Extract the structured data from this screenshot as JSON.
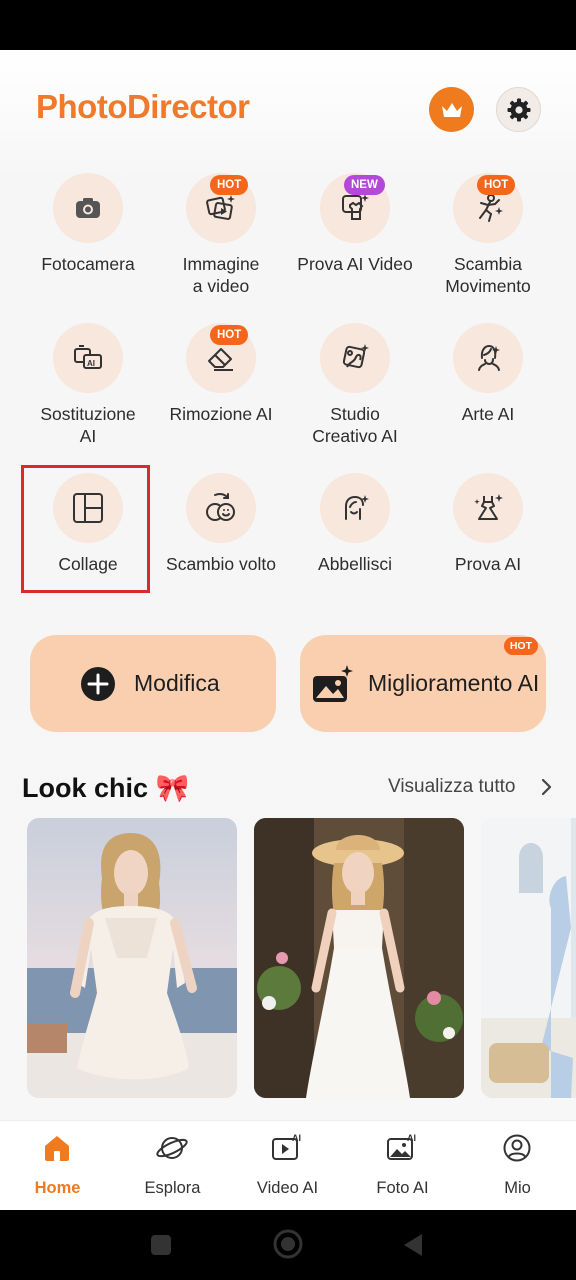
{
  "app": {
    "title": "PhotoDirector"
  },
  "tools": [
    {
      "label": "Fotocamera",
      "icon": "camera-icon"
    },
    {
      "label": "Immagine a video",
      "icon": "image-to-video-icon",
      "badge": "HOT"
    },
    {
      "label": "Prova AI Video",
      "icon": "ai-video-try-on-icon",
      "badge": "NEW"
    },
    {
      "label": "Scambia Movimento",
      "icon": "motion-swap-icon",
      "badge": "HOT"
    },
    {
      "label": "Sostituzione AI",
      "icon": "ai-replace-icon"
    },
    {
      "label": "Rimozione AI",
      "icon": "eraser-icon",
      "badge": "HOT"
    },
    {
      "label": "Studio Creativo AI",
      "icon": "creative-studio-icon"
    },
    {
      "label": "Arte AI",
      "icon": "ai-art-icon"
    },
    {
      "label": "Collage",
      "icon": "collage-icon"
    },
    {
      "label": "Scambio volto",
      "icon": "face-swap-icon"
    },
    {
      "label": "Abbellisci",
      "icon": "beautify-icon"
    },
    {
      "label": "Prova AI",
      "icon": "dress-try-on-icon"
    }
  ],
  "actions": {
    "edit_label": "Modifica",
    "enhance_label": "Miglioramento AI",
    "enhance_badge": "HOT"
  },
  "section": {
    "title": "Look chic 🎀",
    "see_all": "Visualizza tutto"
  },
  "nav": [
    {
      "label": "Home",
      "icon": "home-icon",
      "active": true
    },
    {
      "label": "Esplora",
      "icon": "planet-icon"
    },
    {
      "label": "Video AI",
      "icon": "ai-video-icon"
    },
    {
      "label": "Foto AI",
      "icon": "ai-photo-icon"
    },
    {
      "label": "Mio",
      "icon": "profile-icon"
    }
  ],
  "colors": {
    "brand": "#f07a2c",
    "hot_badge": "#f5661a",
    "new_badge": "#b448d8",
    "highlight": "#d92b2b",
    "tool_bg": "#f7e7dd",
    "action_bg": "#f9cfaf"
  }
}
